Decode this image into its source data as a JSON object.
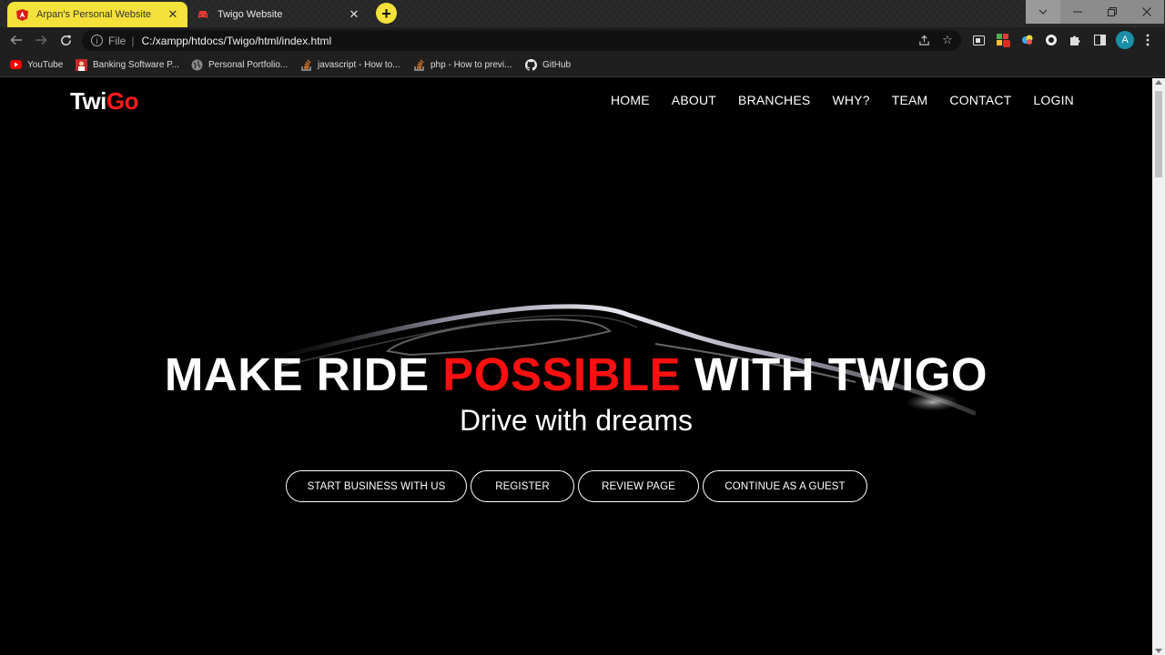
{
  "browser": {
    "tabs": [
      {
        "title": "Arpan's Personal Website",
        "active": false
      },
      {
        "title": "Twigo Website",
        "active": true
      }
    ],
    "new_tab": "+",
    "address": {
      "scheme": "File",
      "separator": "|",
      "url": "C:/xampp/htdocs/Twigo/html/index.html"
    },
    "profile_initial": "A",
    "bookmarks": [
      {
        "label": "YouTube",
        "icon": "youtube-icon"
      },
      {
        "label": "Banking Software P...",
        "icon": "photo-icon"
      },
      {
        "label": "Personal Portfolio...",
        "icon": "globe-icon"
      },
      {
        "label": "javascript - How to...",
        "icon": "stackoverflow-icon"
      },
      {
        "label": "php - How to previ...",
        "icon": "stackoverflow-icon"
      },
      {
        "label": "GitHub",
        "icon": "github-icon"
      }
    ],
    "colors": {
      "tab_accent": "#f4e13a",
      "avatar": "#1b8fa6"
    }
  },
  "site": {
    "logo": {
      "part1": "Twi",
      "part2": "Go"
    },
    "nav": [
      "HOME",
      "ABOUT",
      "BRANCHES",
      "WHY?",
      "TEAM",
      "CONTACT",
      "LOGIN"
    ],
    "hero": {
      "headline_part1": "MAKE RIDE ",
      "headline_accent": "POSSIBLE",
      "headline_part2": " WITH TWIGO",
      "subheadline": "Drive with dreams"
    },
    "buttons": [
      "START BUSINESS WITH US",
      "REGISTER",
      "REVIEW PAGE",
      "CONTINUE AS A GUEST"
    ],
    "colors": {
      "accent": "#ff1a1a",
      "background": "#000000",
      "text": "#ffffff"
    }
  }
}
